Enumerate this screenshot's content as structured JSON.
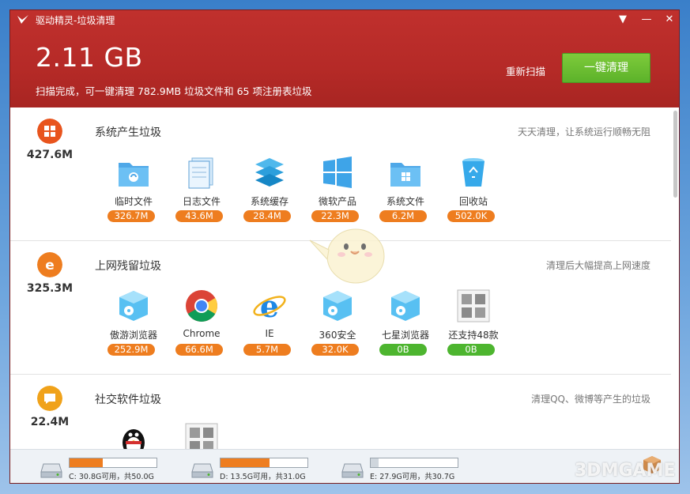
{
  "window": {
    "title": "驱动精灵-垃圾清理"
  },
  "titlebar_buttons": [
    {
      "name": "dropdown-menu-icon",
      "glyph": "▼"
    },
    {
      "name": "minimize-icon",
      "glyph": "—"
    },
    {
      "name": "close-icon",
      "glyph": "✕"
    }
  ],
  "header": {
    "total_size": "2.11 GB",
    "summary": "扫描完成，可一键清理 782.9MB 垃圾文件和 65 项注册表垃圾",
    "rescan_label": "重新扫描",
    "clean_label": "一键清理"
  },
  "sections": [
    {
      "title": "系统产生垃圾",
      "tip": "天天清理，让系统运行顺畅无阻",
      "size": "427.6M",
      "icon": "windows-logo-icon",
      "color": "#e8541d",
      "items": [
        {
          "label": "临时文件",
          "value": "326.7M",
          "icon": "temp-folder-icon"
        },
        {
          "label": "日志文件",
          "value": "43.6M",
          "icon": "log-file-icon"
        },
        {
          "label": "系统缓存",
          "value": "28.4M",
          "icon": "system-cache-icon"
        },
        {
          "label": "微软产品",
          "value": "22.3M",
          "icon": "windows-product-icon"
        },
        {
          "label": "系统文件",
          "value": "6.2M",
          "icon": "system-folder-icon"
        },
        {
          "label": "回收站",
          "value": "502.0K",
          "icon": "recycle-bin-icon"
        }
      ]
    },
    {
      "title": "上网残留垃圾",
      "tip": "清理后大幅提高上网速度",
      "size": "325.3M",
      "icon": "ie-browser-icon",
      "color": "#ee7d1f",
      "items": [
        {
          "label": "傲游浏览器",
          "value": "252.9M",
          "icon": "maxthon-browser-icon",
          "green": false
        },
        {
          "label": "Chrome",
          "value": "66.6M",
          "icon": "chrome-icon",
          "green": false
        },
        {
          "label": "IE",
          "value": "5.7M",
          "icon": "ie-icon",
          "green": false
        },
        {
          "label": "360安全",
          "value": "32.0K",
          "icon": "360-browser-icon",
          "green": false
        },
        {
          "label": "七星浏览器",
          "value": "0B",
          "icon": "qixing-browser-icon",
          "green": true
        },
        {
          "label": "还支持48款",
          "value": "0B",
          "icon": "more-browsers-icon",
          "green": true
        }
      ]
    },
    {
      "title": "社交软件垃圾",
      "tip": "清理QQ、微博等产生的垃圾",
      "size": "22.4M",
      "icon": "chat-bubble-icon",
      "color": "#f0a21a",
      "items": [
        {
          "label": "",
          "value": "",
          "icon": "qq-penguin-icon"
        },
        {
          "label": "",
          "value": "",
          "icon": "more-social-icon"
        }
      ]
    }
  ],
  "drives": [
    {
      "text": "C: 30.8G可用，共50.0G",
      "used_fraction": 0.38
    },
    {
      "text": "D: 13.5G可用，共31.0G",
      "used_fraction": 0.56
    },
    {
      "text": "E: 27.9G可用，共30.7G",
      "used_fraction": 0.09
    }
  ],
  "watermark": "3DMGAME"
}
